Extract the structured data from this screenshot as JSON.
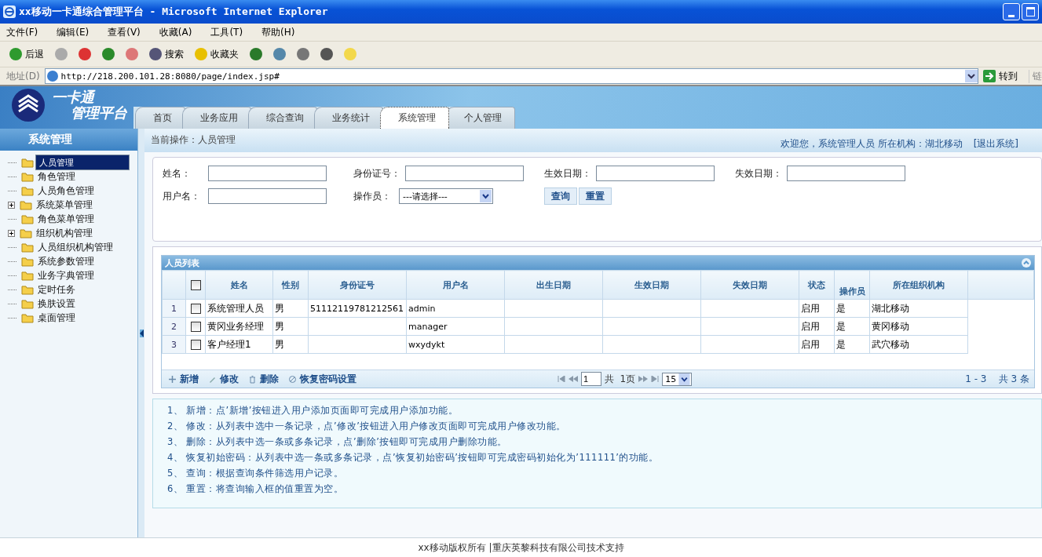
{
  "window": {
    "title": "xx移动一卡通综合管理平台 - Microsoft Internet Explorer"
  },
  "menu": [
    "文件(F)",
    "编辑(E)",
    "查看(V)",
    "收藏(A)",
    "工具(T)",
    "帮助(H)"
  ],
  "toolbar": [
    {
      "kind": "back",
      "label": "后退"
    },
    {
      "kind": "forward"
    },
    {
      "kind": "stop"
    },
    {
      "kind": "refresh"
    },
    {
      "kind": "home"
    },
    {
      "kind": "search",
      "label": "搜索"
    },
    {
      "kind": "favorites",
      "label": "收藏夹"
    },
    {
      "kind": "history"
    },
    {
      "kind": "mail"
    },
    {
      "kind": "print"
    },
    {
      "kind": "edit"
    },
    {
      "kind": "note"
    }
  ],
  "address": {
    "label": "地址(D)",
    "value": "http://218.200.101.28:8080/page/index.jsp#",
    "go": "转到",
    "links": "链"
  },
  "header": {
    "logo_line1": "一卡通",
    "logo_line2": "管理平台"
  },
  "tabs": [
    {
      "label": "首页",
      "selected": false
    },
    {
      "label": "业务应用",
      "selected": false
    },
    {
      "label": "综合查询",
      "selected": false
    },
    {
      "label": "业务统计",
      "selected": false
    },
    {
      "label": "系统管理",
      "selected": true
    },
    {
      "label": "个人管理",
      "selected": false
    }
  ],
  "sidebar": {
    "title": "系统管理",
    "items": [
      {
        "label": "人员管理",
        "kind": "leaf",
        "selected": true
      },
      {
        "label": "角色管理",
        "kind": "leaf",
        "selected": false
      },
      {
        "label": "人员角色管理",
        "kind": "leaf",
        "selected": false
      },
      {
        "label": "系统菜单管理",
        "kind": "branch",
        "selected": false
      },
      {
        "label": "角色菜单管理",
        "kind": "leaf",
        "selected": false
      },
      {
        "label": "组织机构管理",
        "kind": "branch",
        "selected": false
      },
      {
        "label": "人员组织机构管理",
        "kind": "leaf",
        "selected": false
      },
      {
        "label": "系统参数管理",
        "kind": "leaf",
        "selected": false
      },
      {
        "label": "业务字典管理",
        "kind": "leaf",
        "selected": false
      },
      {
        "label": "定时任务",
        "kind": "leaf",
        "selected": false
      },
      {
        "label": "换肤设置",
        "kind": "leaf",
        "selected": false
      },
      {
        "label": "桌面管理",
        "kind": "leaf",
        "selected": false
      }
    ]
  },
  "breadcrumb": "当前操作：人员管理",
  "welcome": "欢迎您，系统管理人员  所在机构：湖北移动",
  "logout": "[退出系统]",
  "search_form": {
    "fields": [
      {
        "label": "姓名：",
        "kind": "text"
      },
      {
        "label": "身份证号：",
        "kind": "text"
      },
      {
        "label": "生效日期：",
        "kind": "text"
      },
      {
        "label": "失效日期：",
        "kind": "text"
      },
      {
        "label": "用户名：",
        "kind": "text"
      },
      {
        "label": "操作员：",
        "kind": "select",
        "value": "---请选择---"
      }
    ],
    "buttons": [
      "查询",
      "重置"
    ]
  },
  "table": {
    "title": "人员列表",
    "columns": [
      "姓名",
      "性别",
      "身份证号",
      "用户名",
      "出生日期",
      "生效日期",
      "失效日期",
      "状态",
      "操作员",
      "所在组织机构"
    ],
    "header_checked": false,
    "rows": [
      {
        "index": "1",
        "checked": false,
        "cells": [
          "系统管理人员",
          "男",
          "51112119781212561",
          "admin",
          "",
          "",
          "",
          "启用",
          "是",
          "湖北移动"
        ]
      },
      {
        "index": "2",
        "checked": false,
        "cells": [
          "黄冈业务经理",
          "男",
          "",
          "manager",
          "",
          "",
          "",
          "启用",
          "是",
          "黄冈移动"
        ]
      },
      {
        "index": "3",
        "checked": false,
        "cells": [
          "客户经理1",
          "男",
          "",
          "wxydykt",
          "",
          "",
          "",
          "启用",
          "是",
          "武穴移动"
        ]
      }
    ],
    "actions": [
      {
        "kind": "add",
        "label": "新增"
      },
      {
        "kind": "edit",
        "label": "修改"
      },
      {
        "kind": "delete",
        "label": "删除"
      },
      {
        "kind": "reset",
        "label": "恢复密码设置"
      }
    ],
    "pager": {
      "page": "1",
      "total_pages": "共  1页",
      "page_size": "15",
      "summary": "1 - 3    共 3 条"
    }
  },
  "help": [
    "1、 新增：点’新增’按钮进入用户添加页面即可完成用户添加功能。",
    "2、 修改：从列表中选中一条记录，点’修改’按钮进入用户修改页面即可完成用户修改功能。",
    "3、 删除：从列表中选一条或多条记录，点’删除’按钮即可完成用户删除功能。",
    "4、 恢复初始密码：从列表中选一条或多条记录，点’恢复初始密码’按钮即可完成密码初始化为’111111’的功能。",
    "5、 查询：根据查询条件筛选用户记录。",
    "6、 重置：将查询输入框的值重置为空。"
  ],
  "footer": "xx移动版权所有  |重庆英黎科技有限公司技术支持"
}
